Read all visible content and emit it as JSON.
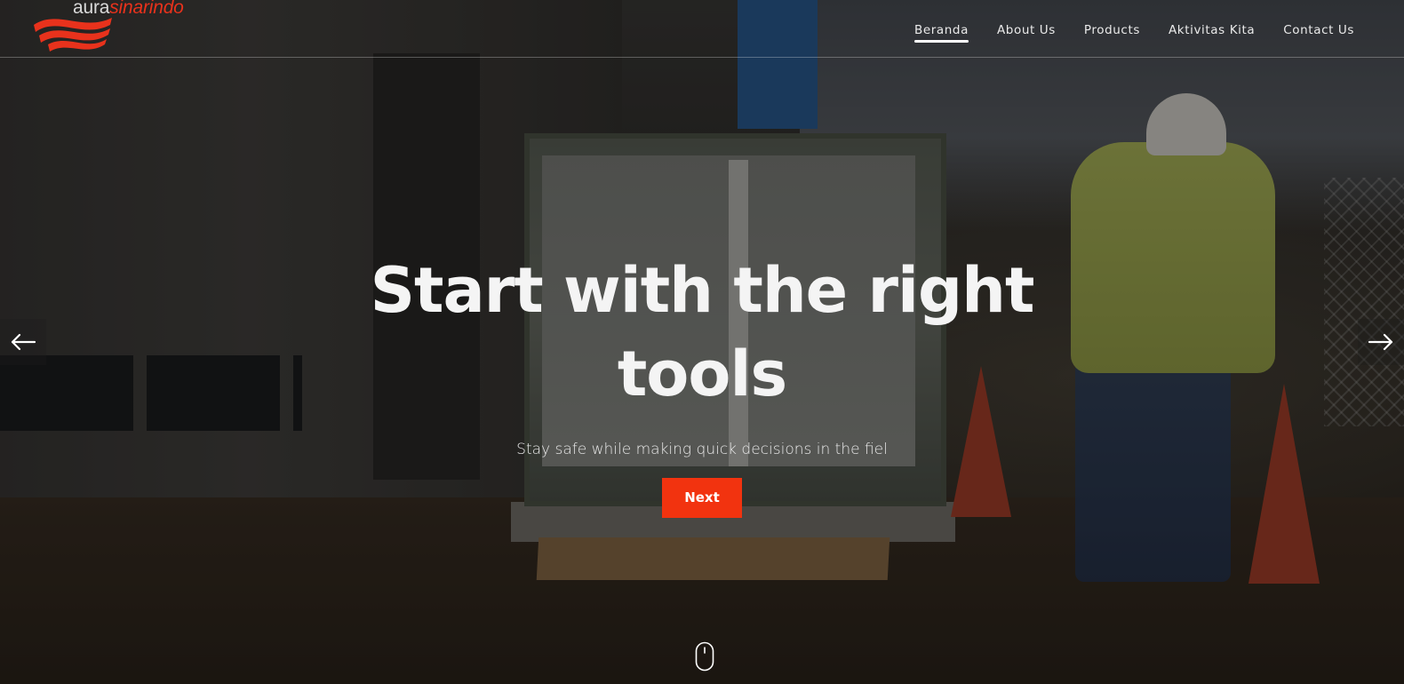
{
  "brand": {
    "name_part1": "aura",
    "name_part2": "sinarindo",
    "primary_color": "#e8321c"
  },
  "nav": {
    "items": [
      {
        "label": "Beranda",
        "active": true
      },
      {
        "label": "About Us",
        "active": false
      },
      {
        "label": "Products",
        "active": false
      },
      {
        "label": "Aktivitas Kita",
        "active": false
      },
      {
        "label": "Contact Us",
        "active": false
      }
    ]
  },
  "hero": {
    "title": "Start with the right tools",
    "subtitle": "Stay safe while making quick decisions in the fiel",
    "cta_label": "Next",
    "cta_color": "#f2330f"
  },
  "slider": {
    "prev_icon": "arrow-left-icon",
    "next_icon": "arrow-right-icon"
  },
  "scroll": {
    "icon": "mouse-scroll-icon"
  }
}
